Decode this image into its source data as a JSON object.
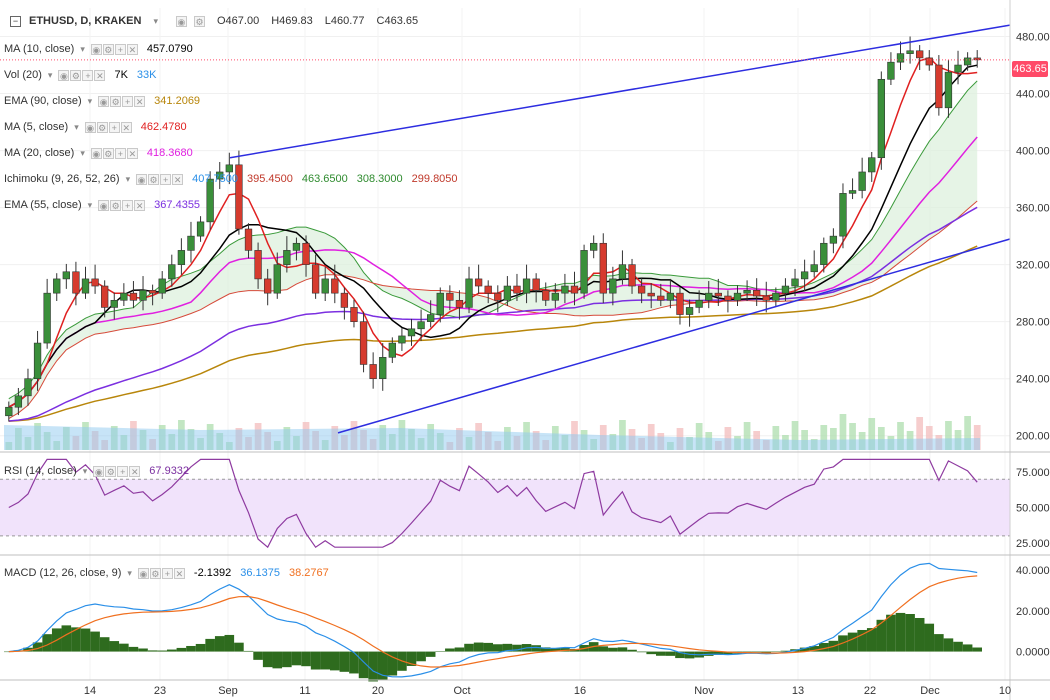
{
  "header": {
    "symbol": "ETHUSD, D, KRAKEN",
    "open": "O467.00",
    "high": "H469.83",
    "low": "L460.77",
    "close": "C463.65"
  },
  "indicators": [
    {
      "name": "MA (10, close)",
      "values": [
        {
          "text": "457.0790",
          "color": "#000000"
        }
      ]
    },
    {
      "name": "Vol (20)",
      "values": [
        {
          "text": "7K",
          "color": "#000000"
        },
        {
          "text": "33K",
          "color": "#2a8fe8"
        }
      ]
    },
    {
      "name": "EMA (90, close)",
      "values": [
        {
          "text": "341.2069",
          "color": "#b8860b"
        }
      ]
    },
    {
      "name": "MA (5, close)",
      "values": [
        {
          "text": "462.4780",
          "color": "#e02020"
        }
      ]
    },
    {
      "name": "MA (20, close)",
      "values": [
        {
          "text": "418.3680",
          "color": "#e020e0"
        }
      ]
    },
    {
      "name": "Ichimoku (9, 26, 52, 26)",
      "values": [
        {
          "text": "407.7500",
          "color": "#2a8fe8"
        },
        {
          "text": "395.4500",
          "color": "#c0392b"
        },
        {
          "text": "463.6500",
          "color": "#2e8b2e"
        },
        {
          "text": "308.3000",
          "color": "#2e8b2e"
        },
        {
          "text": "299.8050",
          "color": "#c0392b"
        }
      ]
    },
    {
      "name": "EMA (55, close)",
      "values": [
        {
          "text": "367.4355",
          "color": "#7b2fe0"
        }
      ]
    }
  ],
  "rsi_legend": {
    "name": "RSI (14, close)",
    "value": "67.9332"
  },
  "macd_legend": {
    "name": "MACD (12, 26, close, 9)",
    "values": [
      {
        "text": "-2.1392",
        "color": "#000000"
      },
      {
        "text": "36.1375",
        "color": "#2a8fe8"
      },
      {
        "text": "38.2767",
        "color": "#f07020"
      }
    ]
  },
  "last_price_label": "463.65",
  "colors": {
    "up": "#3a8f3a",
    "down": "#d63b2e",
    "trendline": "#2d2de0",
    "background": "#ffffff",
    "rsi_band": "#f1e3fb",
    "price_tag": "#ff4a68"
  },
  "chart_data": {
    "type": "candlestick",
    "symbol": "ETHUSD",
    "timeframe": "D",
    "exchange": "KRAKEN",
    "x_labels": [
      "14",
      "23",
      "Sep",
      "11",
      "20",
      "Oct",
      "16",
      "Nov",
      "13",
      "22",
      "Dec",
      "10"
    ],
    "y_ticks": [
      "480.00",
      "440.00",
      "400.00",
      "360.00",
      "320.00",
      "280.00",
      "240.00",
      "200.00"
    ],
    "ylim": [
      190,
      500
    ],
    "closes": [
      220,
      228,
      240,
      265,
      300,
      310,
      315,
      300,
      310,
      305,
      290,
      295,
      300,
      295,
      302,
      300,
      310,
      320,
      330,
      340,
      350,
      380,
      385,
      390,
      345,
      330,
      310,
      300,
      320,
      330,
      335,
      320,
      300,
      310,
      300,
      290,
      280,
      250,
      240,
      255,
      265,
      270,
      275,
      280,
      285,
      300,
      295,
      290,
      310,
      305,
      300,
      295,
      305,
      300,
      310,
      302,
      295,
      300,
      305,
      300,
      330,
      335,
      300,
      310,
      320,
      305,
      300,
      298,
      295,
      300,
      285,
      290,
      295,
      300,
      298,
      295,
      300,
      302,
      298,
      295,
      300,
      305,
      310,
      315,
      320,
      335,
      340,
      370,
      372,
      385,
      395,
      450,
      462,
      468,
      470,
      465,
      460,
      430,
      455,
      460,
      465,
      463.65
    ],
    "ma5_last": 462.478,
    "ma10_last": 457.079,
    "ma20_last": 418.368,
    "ema55_last": 367.4355,
    "ema90_last": 341.2069,
    "volume_last": "7K",
    "volume_ma": "33K",
    "rsi_ticks": [
      "75.0000",
      "50.0000",
      "25.0000"
    ],
    "rsi_last": 67.9332,
    "macd_ticks": [
      "40.0000",
      "20.0000",
      "0.0000"
    ],
    "macd_hist_last": -2.1392,
    "macd_line_last": 36.1375,
    "macd_signal_last": 38.2767
  }
}
